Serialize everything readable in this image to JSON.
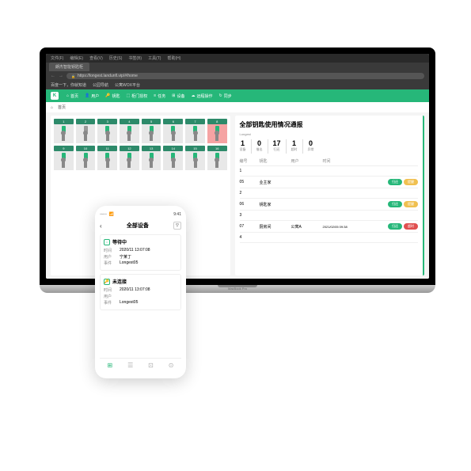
{
  "browser": {
    "titlebar": [
      "文件(F)",
      "编辑(E)",
      "查看(V)",
      "历史(S)",
      "书签(B)",
      "工具(T)",
      "帮助(H)"
    ],
    "tab_title": "朗杰智能钥匙柜",
    "url": "https://longest.landunfl.vip/#/home",
    "bookmarks": [
      "百度一下，你就知道",
      "公园导航",
      "公寓WOX平台"
    ],
    "secure_icon": "🔒",
    "back_icon": "←",
    "fwd_icon": "→"
  },
  "app": {
    "logo": "K",
    "nav": [
      {
        "icon": "⌂",
        "label": "首页"
      },
      {
        "icon": "👤",
        "label": "用户"
      },
      {
        "icon": "🔑",
        "label": "钥匙"
      },
      {
        "icon": "⬚",
        "label": "柜门授权"
      },
      {
        "icon": "≡",
        "label": "任务"
      },
      {
        "icon": "⊞",
        "label": "设备"
      },
      {
        "icon": "☁",
        "label": "远程操作"
      },
      {
        "icon": "↻",
        "label": "同步"
      }
    ],
    "breadcrumb": "首页",
    "keys": {
      "row1": [
        "1",
        "2",
        "3",
        "4",
        "5",
        "6",
        "7",
        "8"
      ],
      "row2": [
        "9",
        "10",
        "11",
        "12",
        "13",
        "14",
        "15",
        "16"
      ],
      "alert_slot": "8",
      "gray_slots": [
        "2"
      ]
    },
    "report": {
      "title": "全部钥匙使用情况通报",
      "subtitle": "Longest",
      "stats": [
        {
          "value": "1",
          "label": "设备"
        },
        {
          "value": "0",
          "label": "借出"
        },
        {
          "value": "17",
          "label": "归还"
        },
        {
          "value": "1",
          "label": "超时"
        },
        {
          "value": "0",
          "label": "异常"
        }
      ],
      "columns": [
        "编号",
        "钥匙",
        "用户",
        "时间"
      ],
      "rows": [
        {
          "id": "1",
          "key": "",
          "user": "",
          "time": "",
          "badges": []
        },
        {
          "id": "05",
          "key": "业主家",
          "user": "",
          "time": "",
          "badges": [
            "green",
            "yellow"
          ]
        },
        {
          "id": "2",
          "key": "",
          "user": "",
          "time": "",
          "badges": []
        },
        {
          "id": "06",
          "key": "钥匙家",
          "user": "",
          "time": "",
          "badges": [
            "green",
            "yellow"
          ]
        },
        {
          "id": "3",
          "key": "",
          "user": "",
          "time": "",
          "badges": []
        },
        {
          "id": "07",
          "key": "厨房间",
          "user": "公寓A",
          "time": "2021/02/05 09:38",
          "badges": [
            "green",
            "red"
          ]
        },
        {
          "id": "4",
          "key": "",
          "user": "",
          "time": "",
          "badges": []
        }
      ],
      "badge_labels": {
        "green": "归还",
        "yellow": "提醒",
        "red": "超时"
      }
    }
  },
  "phone": {
    "time": "9:41",
    "carrier": "◦◦◦◦◦",
    "wifi": "📶",
    "title": "全部设备",
    "back": "‹",
    "filter": "▽",
    "cards": [
      {
        "icon": "↓",
        "title": "等待中",
        "rows": [
          {
            "label": "时间",
            "value": "2020/11 13:07:08"
          },
          {
            "label": "用户",
            "value": "宁某丁"
          },
          {
            "label": "事件",
            "value": "Longest05"
          }
        ]
      },
      {
        "icon": "🔑",
        "title": "未连接",
        "rows": [
          {
            "label": "时间",
            "value": "2020/11 13:07:08"
          },
          {
            "label": "用户",
            "value": ""
          },
          {
            "label": "事件",
            "value": "Longest05"
          }
        ]
      }
    ],
    "tabs": [
      "⊞",
      "☰",
      "⊡",
      "⊙"
    ]
  }
}
